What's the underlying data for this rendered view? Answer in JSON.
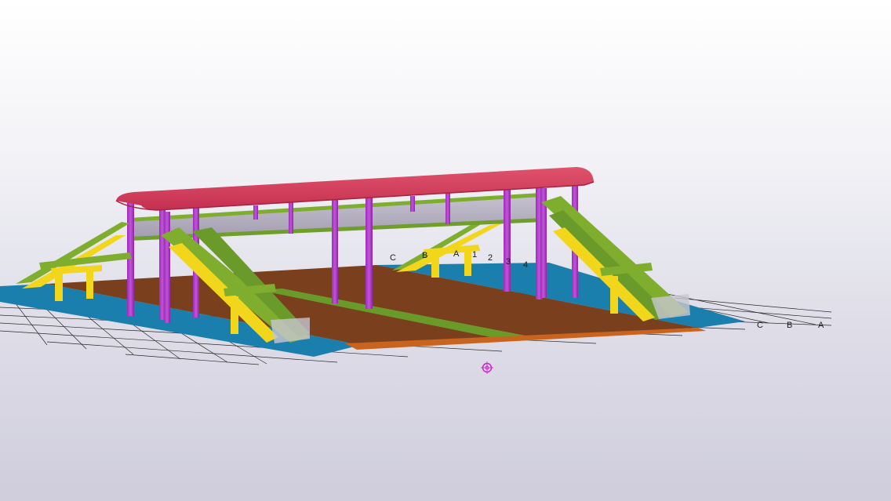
{
  "grid_labels": {
    "near_row": [
      "C",
      "B",
      "A",
      "1",
      "2",
      "3",
      "4"
    ],
    "far_row": [
      "C",
      "B",
      "A"
    ]
  },
  "colors": {
    "roof": "#d23a55",
    "roof_edge": "#b02845",
    "columns": "#b23fc9",
    "walkway_panel": "#b3aebe",
    "stair_rail": "#7fae2f",
    "stair_yellow": "#f2d61c",
    "platform_blue": "#1b7fae",
    "track_brown": "#7a3f1c",
    "track_green": "#6a9a2a",
    "track_orange": "#c8641e",
    "grid_lines": "#2a2a2a",
    "view_point": "#cc22cc"
  },
  "icons": {
    "view_rotation_point": "view-rotation-point-icon"
  }
}
